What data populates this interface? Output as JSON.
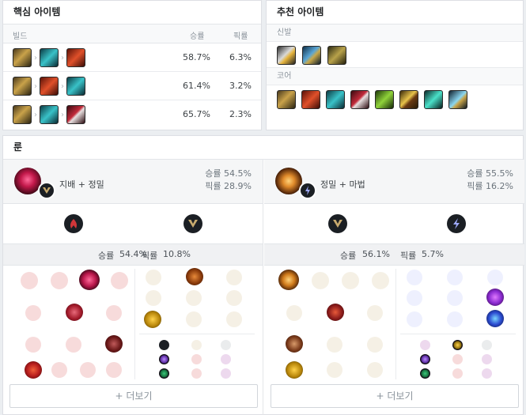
{
  "core_items": {
    "title": "핵심 아이템",
    "headers": {
      "build": "빌드",
      "win_rate": "승률",
      "pick_rate": "픽률"
    },
    "arrow": "›",
    "rows": [
      {
        "win_rate": "58.7%",
        "pick_rate": "6.3%"
      },
      {
        "win_rate": "61.4%",
        "pick_rate": "3.2%"
      },
      {
        "win_rate": "65.7%",
        "pick_rate": "2.3%"
      }
    ]
  },
  "recommended_items": {
    "title": "추천 아이템",
    "boots_label": "신발",
    "core_label": "코어"
  },
  "runes": {
    "title": "룬",
    "pages": [
      {
        "name": "지배 + 정밀",
        "win_rate_label": "승률",
        "win_rate": "54.5%",
        "pick_rate_label": "픽률",
        "pick_rate": "28.9%",
        "detail_win_label": "승률",
        "detail_win": "54.4%",
        "detail_pick_label": "픽률",
        "detail_pick": "10.8%",
        "more": "+ 더보기"
      },
      {
        "name": "정밀 + 마법",
        "win_rate_label": "승률",
        "win_rate": "55.5%",
        "pick_rate_label": "픽률",
        "pick_rate": "16.2%",
        "detail_win_label": "승률",
        "detail_win": "56.1%",
        "detail_pick_label": "픽률",
        "detail_pick": "5.7%",
        "more": "+ 더보기"
      }
    ]
  },
  "colors": {
    "domination": "#d13639",
    "precision": "#c8aa6e",
    "sorcery": "#9faafc",
    "panel_border": "#dddfe4",
    "background": "#ebeef1"
  }
}
